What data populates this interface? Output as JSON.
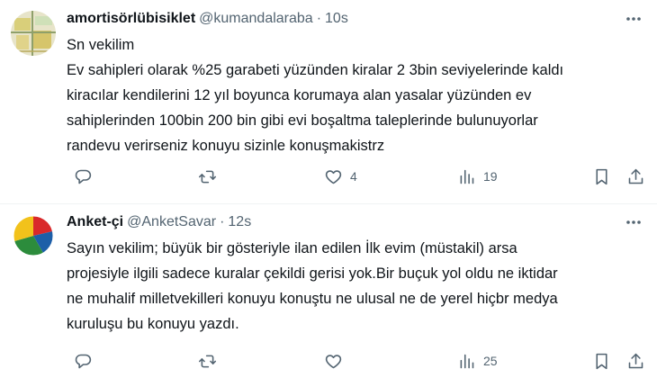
{
  "tweets": [
    {
      "display_name": "amortisörlübisiklet",
      "handle": "@kumandalaraba",
      "separator": "·",
      "time": "10s",
      "lines": [
        "Sn vekilim",
        "Ev sahipleri olarak %25 garabeti yüzünden kiralar 2 3bin seviyelerinde kaldı",
        "kiracılar kendilerini 12 yıl boyunca korumaya alan yasalar yüzünden ev",
        "sahiplerinden 100bin 200 bin gibi evi boşaltma taleplerinde bulunuyorlar",
        "randevu verirseniz konuyu sizinle konuşmakistrz"
      ],
      "stats": {
        "replies": "",
        "retweets": "",
        "likes": "4",
        "views": "19"
      }
    },
    {
      "display_name": "Anket-çi",
      "handle": "@AnketSavar",
      "separator": "·",
      "time": "12s",
      "lines": [
        "Sayın vekilim; büyük bir gösteriyle ilan edilen İlk evim (müstakil) arsa",
        "projesiyle ilgili sadece kuralar çekildi gerisi yok.Bir buçuk yol oldu ne iktidar",
        "ne muhalif milletvekilleri konuyu konuştu ne ulusal ne de yerel hiçbr medya",
        "kuruluşu bu konuyu yazdı."
      ],
      "stats": {
        "replies": "",
        "retweets": "",
        "likes": "",
        "views": "25"
      }
    }
  ],
  "icons": {
    "more": "more-horizontal-icon",
    "reply": "reply-icon",
    "retweet": "retweet-icon",
    "like": "heart-icon",
    "views": "views-chart-icon",
    "bookmark": "bookmark-icon",
    "share": "share-icon"
  },
  "colors": {
    "text": "#0f1419",
    "secondary": "#536471",
    "divider": "#eff3f4"
  }
}
